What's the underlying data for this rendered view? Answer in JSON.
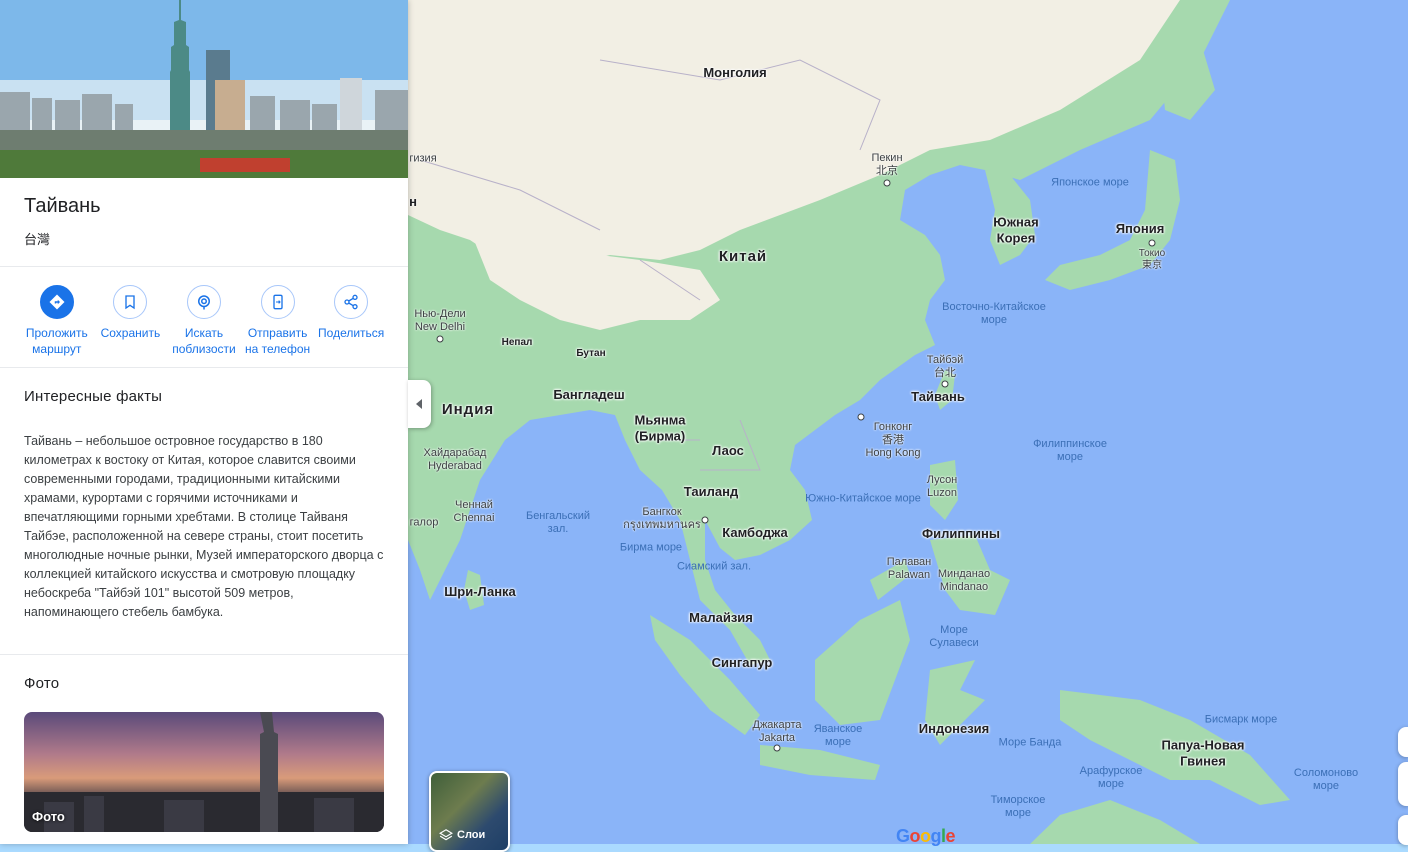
{
  "place": {
    "title": "Тайвань",
    "native_name": "台灣"
  },
  "actions": [
    {
      "label": "Проложить маршрут",
      "icon": "directions-icon"
    },
    {
      "label": "Сохранить",
      "icon": "bookmark-icon"
    },
    {
      "label": "Искать поблизости",
      "icon": "nearby-icon"
    },
    {
      "label": "Отправить на телефон",
      "icon": "send-to-phone-icon"
    },
    {
      "label": "Поделиться",
      "icon": "share-icon"
    }
  ],
  "facts": {
    "heading": "Интересные факты",
    "text": "Тайвань – небольшое островное государство в 180 километрах к востоку от Китая, которое славится своими современными городами, традиционными китайскими храмами, курортами с горячими источниками и впечатляющими горными хребтами. В столице Тайваня Тайбэе, расположенной на севере страны, стоит посетить многолюдные ночные рынки, Музей императорского дворца с коллекцией китайского искусства и смотровую площадку небоскреба \"Тайбэй 101\" высотой 509 метров, напоминающего стебель бамбука."
  },
  "photos": {
    "heading": "Фото",
    "card_caption": "Фото"
  },
  "map": {
    "layers_label": "Слои",
    "logo": "Google",
    "countries": {
      "mongolia": "Монголия",
      "china": "Китай",
      "south_korea": "Южная Корея",
      "japan": "Япония",
      "india": "Индия",
      "nepal": "Непал",
      "bhutan": "Бутан",
      "bangladesh": "Бангладеш",
      "myanmar": "Мьянма (Бирма)",
      "laos": "Лаос",
      "thailand": "Таиланд",
      "cambodia": "Камбоджа",
      "taiwan": "Тайвань",
      "philippines": "Филиппины",
      "malaysia": "Малайзия",
      "singapore": "Сингапур",
      "indonesia": "Индонезия",
      "png": "Папуа-Новая Гвинея",
      "sri_lanka": "Шри-Ланка"
    },
    "cities": {
      "beijing": "Пекин\n北京",
      "tokyo": "Токио\n東京",
      "new_delhi": "Нью-Дели\nNew Delhi",
      "taipei": "Тайбэй\n台北",
      "hong_kong": "Гонконг\n香港\nHong Kong",
      "hyderabad": "Хайдарабад\nHyderabad",
      "chennai": "Ченнай\nChennai",
      "bangkok": "Бангкок\nกรุงเทพมหานคร",
      "luzon": "Лусон\nLuzon",
      "palawan": "Палаван\nPalawan",
      "mindanao": "Минданао\nMindanao",
      "jakarta": "Джакарта\nJakarta",
      "bangalore": "галор",
      "georgia": "гизия",
      "n_edge": "н"
    },
    "seas": {
      "japan_sea": "Японское море",
      "east_china_sea": "Восточно-Китайское море",
      "philippine_sea": "Филиппинское море",
      "south_china_sea": "Южно-Китайское море",
      "bengal_bay": "Бенгальский зал.",
      "andaman_sea": "Бирма море",
      "siam_gulf": "Сиамский зал.",
      "sulawesi_sea": "Море Сулавеси",
      "java_sea": "Яванское море",
      "banda_sea": "Море Банда",
      "bismarck_sea": "Бисмарк море",
      "arafura_sea": "Арафурское море",
      "solomon_sea": "Соломоново море",
      "timor_sea": "Тиморское море"
    }
  },
  "colors": {
    "accent": "#1a73e8",
    "water": "#8ab4f8",
    "land_green": "#94d2a5",
    "land_sand": "#f3efe5"
  }
}
